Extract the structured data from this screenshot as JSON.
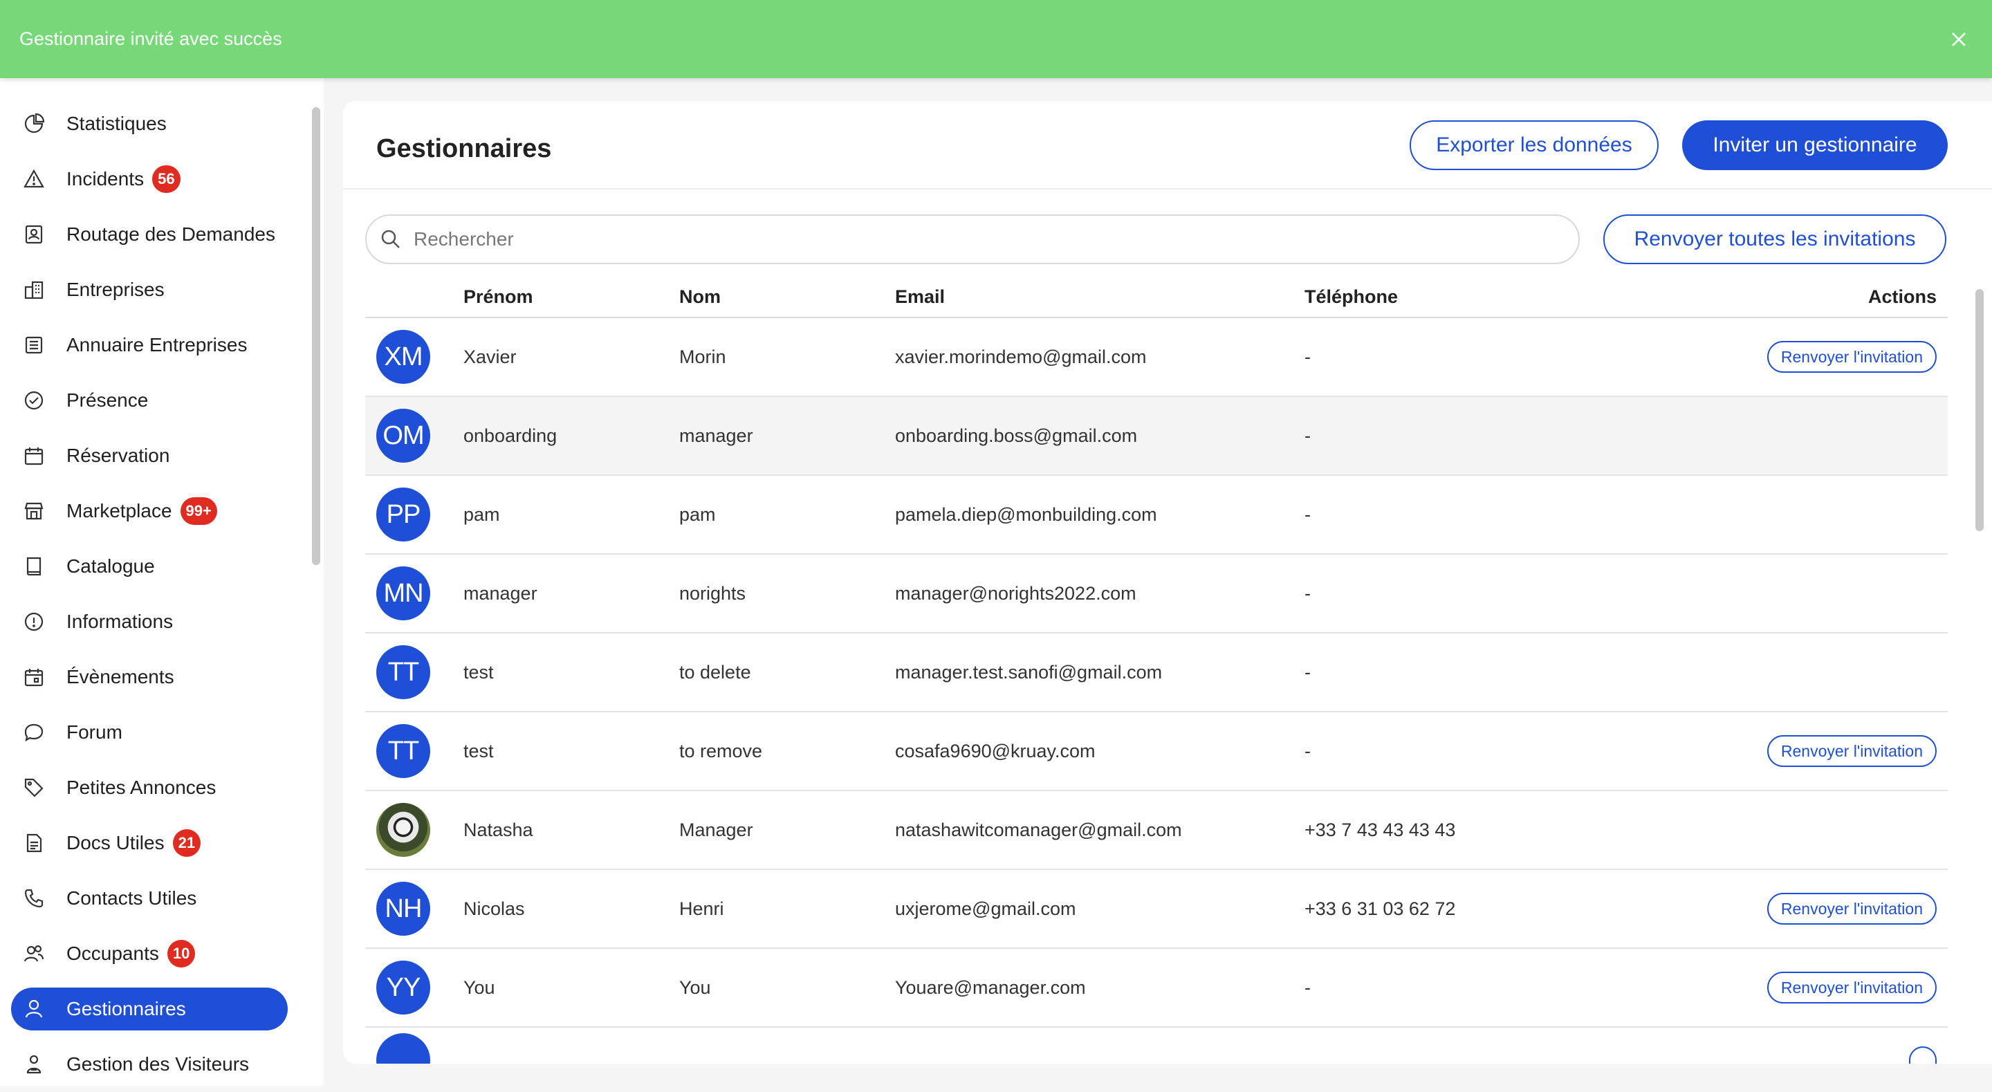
{
  "toast": {
    "message": "Gestionnaire invité avec succès"
  },
  "sidebar": {
    "items": [
      {
        "label": "Statistiques",
        "icon": "pie-chart-icon",
        "badge": ""
      },
      {
        "label": "Incidents",
        "icon": "warning-icon",
        "badge": "56"
      },
      {
        "label": "Routage des Demandes",
        "icon": "contact-card-icon",
        "badge": ""
      },
      {
        "label": "Entreprises",
        "icon": "buildings-icon",
        "badge": ""
      },
      {
        "label": "Annuaire Entreprises",
        "icon": "directory-icon",
        "badge": ""
      },
      {
        "label": "Présence",
        "icon": "check-circle-icon",
        "badge": ""
      },
      {
        "label": "Réservation",
        "icon": "calendar-icon",
        "badge": ""
      },
      {
        "label": "Marketplace",
        "icon": "store-icon",
        "badge": "99+"
      },
      {
        "label": "Catalogue",
        "icon": "book-icon",
        "badge": ""
      },
      {
        "label": "Informations",
        "icon": "info-icon",
        "badge": ""
      },
      {
        "label": "Évènements",
        "icon": "calendar-event-icon",
        "badge": ""
      },
      {
        "label": "Forum",
        "icon": "chat-bubble-icon",
        "badge": ""
      },
      {
        "label": "Petites Annonces",
        "icon": "tag-icon",
        "badge": ""
      },
      {
        "label": "Docs Utiles",
        "icon": "document-icon",
        "badge": "21"
      },
      {
        "label": "Contacts Utiles",
        "icon": "phone-icon",
        "badge": ""
      },
      {
        "label": "Occupants",
        "icon": "users-icon",
        "badge": "10"
      },
      {
        "label": "Gestionnaires",
        "icon": "user-icon",
        "badge": "",
        "active": true
      },
      {
        "label": "Gestion des Visiteurs",
        "icon": "visitor-icon",
        "badge": ""
      }
    ]
  },
  "header": {
    "title": "Gestionnaires",
    "export_label": "Exporter les données",
    "invite_label": "Inviter un gestionnaire"
  },
  "search": {
    "placeholder": "Rechercher",
    "value": ""
  },
  "resend_all_label": "Renvoyer toutes les invitations",
  "table": {
    "columns": {
      "firstname": "Prénom",
      "lastname": "Nom",
      "email": "Email",
      "phone": "Téléphone",
      "actions": "Actions"
    },
    "resend_label": "Renvoyer l'invitation",
    "rows": [
      {
        "initials": "XM",
        "firstname": "Xavier",
        "lastname": "Morin",
        "email": "xavier.morindemo@gmail.com",
        "phone": "-",
        "resend": true
      },
      {
        "initials": "OM",
        "firstname": "onboarding",
        "lastname": "manager",
        "email": "onboarding.boss@gmail.com",
        "phone": "-",
        "resend": false
      },
      {
        "initials": "PP",
        "firstname": "pam",
        "lastname": "pam",
        "email": "pamela.diep@monbuilding.com",
        "phone": "-",
        "resend": false
      },
      {
        "initials": "MN",
        "firstname": "manager",
        "lastname": "norights",
        "email": "manager@norights2022.com",
        "phone": "-",
        "resend": false
      },
      {
        "initials": "TT",
        "firstname": "test",
        "lastname": "to delete",
        "email": "manager.test.sanofi@gmail.com",
        "phone": "-",
        "resend": false
      },
      {
        "initials": "TT",
        "firstname": "test",
        "lastname": "to remove",
        "email": "cosafa9690@kruay.com",
        "phone": "-",
        "resend": true
      },
      {
        "initials": "",
        "photo": true,
        "firstname": "Natasha",
        "lastname": "Manager",
        "email": "natashawitcomanager@gmail.com",
        "phone": "+33 7 43 43 43 43",
        "resend": false
      },
      {
        "initials": "NH",
        "firstname": "Nicolas",
        "lastname": "Henri",
        "email": "uxjerome@gmail.com",
        "phone": "+33 6 31 03 62 72",
        "resend": true
      },
      {
        "initials": "YY",
        "firstname": "You",
        "lastname": "You",
        "email": "Youare@manager.com",
        "phone": "-",
        "resend": true
      }
    ]
  },
  "colors": {
    "accent": "#1f4fd6",
    "toast": "#77d878",
    "badge": "#e02b20"
  }
}
